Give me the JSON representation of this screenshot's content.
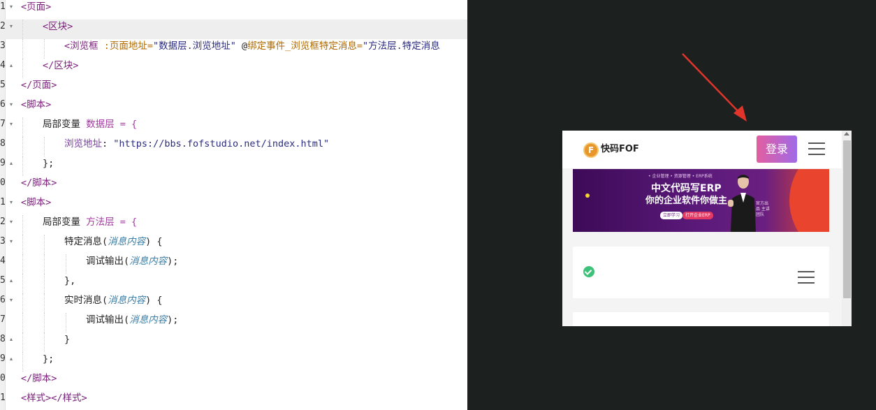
{
  "editor": {
    "line_numbers": [
      "1",
      "2",
      "3",
      "4",
      "5",
      "6",
      "7",
      "8",
      "9",
      "0",
      "1",
      "2",
      "3",
      "4",
      "5",
      "6",
      "7",
      "8",
      "9",
      "0",
      "1"
    ],
    "tokens": {
      "page_open": "<页面>",
      "block_open": "<区块>",
      "browser_tag": "<浏览框",
      "attr_url": " :页面地址=",
      "attr_url_val": "\"数据层.浏览地址\"",
      "event_prefix": " @",
      "event_attr": "绑定事件_浏览框特定消息=",
      "event_val": "\"方法层.特定消息",
      "block_close": "</区块>",
      "page_close": "</页面>",
      "script_open": "<脚本>",
      "local_var": "局部变量",
      "data_layer": "数据层",
      "eq_brace": " = {",
      "url_key": "浏览地址",
      "colon": ": ",
      "url_value": "\"https://bbs.fofstudio.net/index.html\"",
      "close_semicolon": "};",
      "script_close": "</脚本>",
      "method_layer": "方法层",
      "specific_msg": "特定消息",
      "paren_open": "(",
      "msg_param": "消息内容",
      "paren_close_brace": ") {",
      "debug_out": "调试输出",
      "paren_close_semi": ");",
      "brace_comma": "},",
      "realtime_msg": "实时消息",
      "brace_close": "}",
      "style_tags": "<样式></样式>"
    }
  },
  "preview": {
    "brand": "快码FOF",
    "logo_letter": "F",
    "login_label": "登录",
    "banner": {
      "top_tags": "• 企业管理 • 资源管理 • ERP系统",
      "line1": "中文代码写ERP",
      "line2": "你的企业软件你做主",
      "btn_learn": "立即学习",
      "btn_open": "打开企业ERP",
      "side_text": "官方出品 主讲团队"
    }
  },
  "colors": {
    "editor_bg": "#ffffff",
    "right_bg": "#1c2120",
    "login_gradient_start": "#e25ea0",
    "login_gradient_end": "#a06ae8",
    "arrow": "#e0352b",
    "check_green": "#3ec27a"
  },
  "icons": {
    "arrow": "red-arrow-annotation",
    "hamburger": "hamburger-menu-icon",
    "check": "check-circle-icon"
  }
}
